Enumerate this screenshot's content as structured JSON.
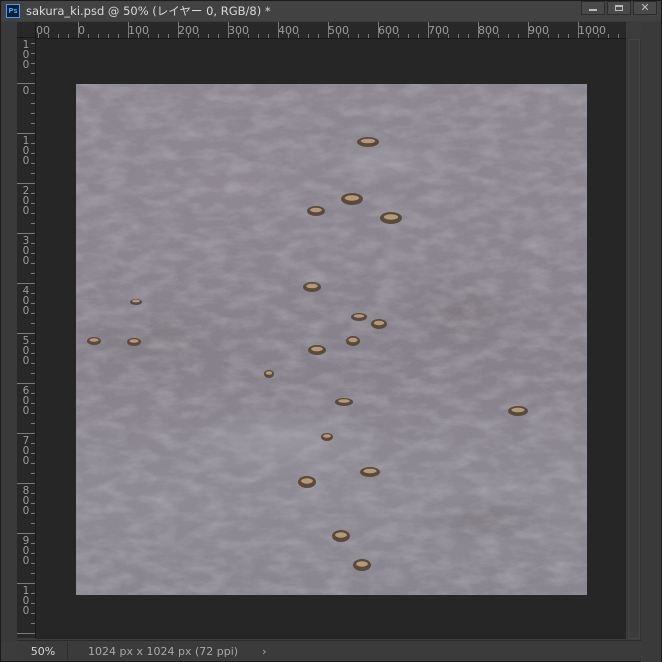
{
  "window": {
    "title": "sakura_ki.psd @ 50% (レイヤー 0, RGB/8) *",
    "app_icon_label": "Ps",
    "controls": {
      "minimize": "minimize-icon",
      "maximize": "maximize-icon",
      "close": "close-icon"
    }
  },
  "ruler_h": {
    "labels": [
      "00",
      "0",
      "100",
      "200",
      "300",
      "400",
      "500",
      "600",
      "700",
      "800",
      "900",
      "1000"
    ]
  },
  "ruler_v": {
    "labels": [
      "100",
      "0",
      "100",
      "200",
      "300",
      "400",
      "500",
      "600",
      "700",
      "800",
      "900",
      "100"
    ]
  },
  "status": {
    "zoom": "50%",
    "doc_info": "1024 px x 1024 px (72 ppi)",
    "arrow": "›"
  },
  "colors": {
    "pasteboard": "#262626",
    "chrome": "#3c3c3c",
    "accent": "#31a8ff"
  }
}
